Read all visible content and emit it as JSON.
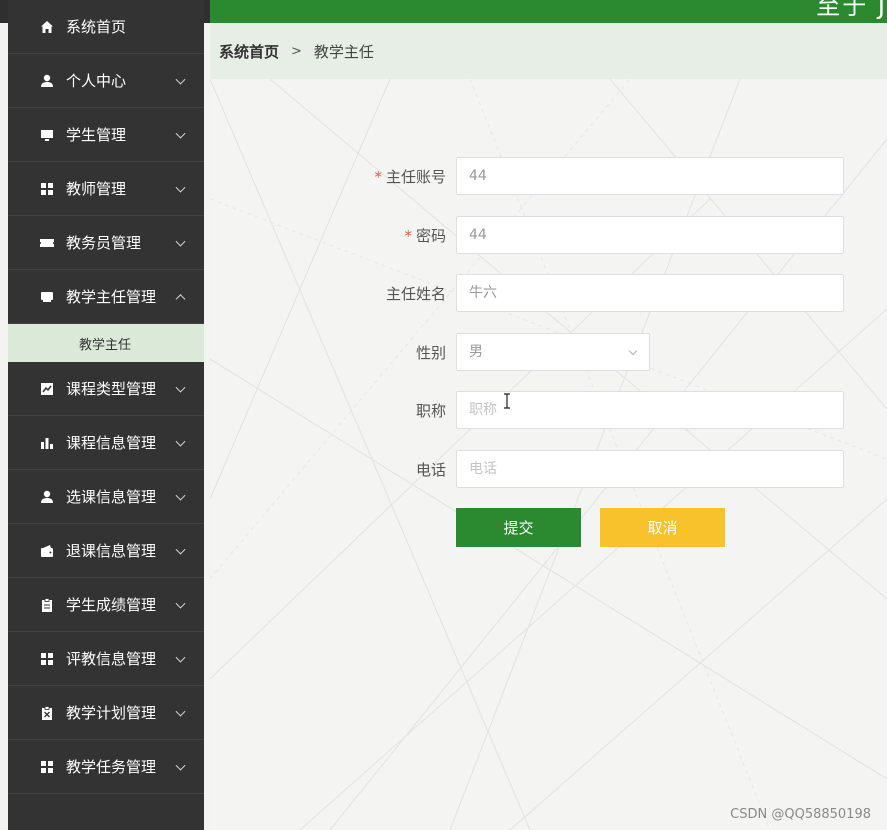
{
  "topbar": {
    "title_fragment": "至于 J"
  },
  "sidebar": {
    "items": [
      {
        "label": "系统首页",
        "icon": "home-icon",
        "chevron": "none"
      },
      {
        "label": "个人中心",
        "icon": "user-icon",
        "chevron": "down"
      },
      {
        "label": "学生管理",
        "icon": "monitor-icon",
        "chevron": "down"
      },
      {
        "label": "教师管理",
        "icon": "grid-icon",
        "chevron": "down"
      },
      {
        "label": "教务员管理",
        "icon": "ticket-icon",
        "chevron": "down"
      },
      {
        "label": "教学主任管理",
        "icon": "tray-icon",
        "chevron": "up"
      }
    ],
    "sub_item": {
      "label": "教学主任"
    },
    "items_after": [
      {
        "label": "课程类型管理",
        "icon": "line-chart-icon",
        "chevron": "down"
      },
      {
        "label": "课程信息管理",
        "icon": "bar-chart-icon",
        "chevron": "down"
      },
      {
        "label": "选课信息管理",
        "icon": "user-icon",
        "chevron": "down"
      },
      {
        "label": "退课信息管理",
        "icon": "wallet-icon",
        "chevron": "down"
      },
      {
        "label": "学生成绩管理",
        "icon": "clipboard-icon",
        "chevron": "down"
      },
      {
        "label": "评教信息管理",
        "icon": "grid-icon",
        "chevron": "down"
      },
      {
        "label": "教学计划管理",
        "icon": "clipboard-x-icon",
        "chevron": "down"
      },
      {
        "label": "教学任务管理",
        "icon": "grid-icon",
        "chevron": "down"
      }
    ]
  },
  "breadcrumb": {
    "home": "系统首页",
    "separator": ">",
    "current": "教学主任"
  },
  "form": {
    "account": {
      "label": "主任账号",
      "required": "*",
      "value": "44"
    },
    "password": {
      "label": "密码",
      "required": "*",
      "value": "44"
    },
    "name": {
      "label": "主任姓名",
      "value": "牛六"
    },
    "gender": {
      "label": "性别",
      "value": "男"
    },
    "title": {
      "label": "职称",
      "placeholder": "职称"
    },
    "phone": {
      "label": "电话",
      "placeholder": "电话"
    },
    "submit_label": "提交",
    "cancel_label": "取消"
  },
  "watermark": "CSDN @QQ58850198",
  "colors": {
    "primary": "#2b8a2f",
    "warning": "#f7c22c",
    "sidebar": "#333333",
    "submenu": "#dbe9d8"
  }
}
